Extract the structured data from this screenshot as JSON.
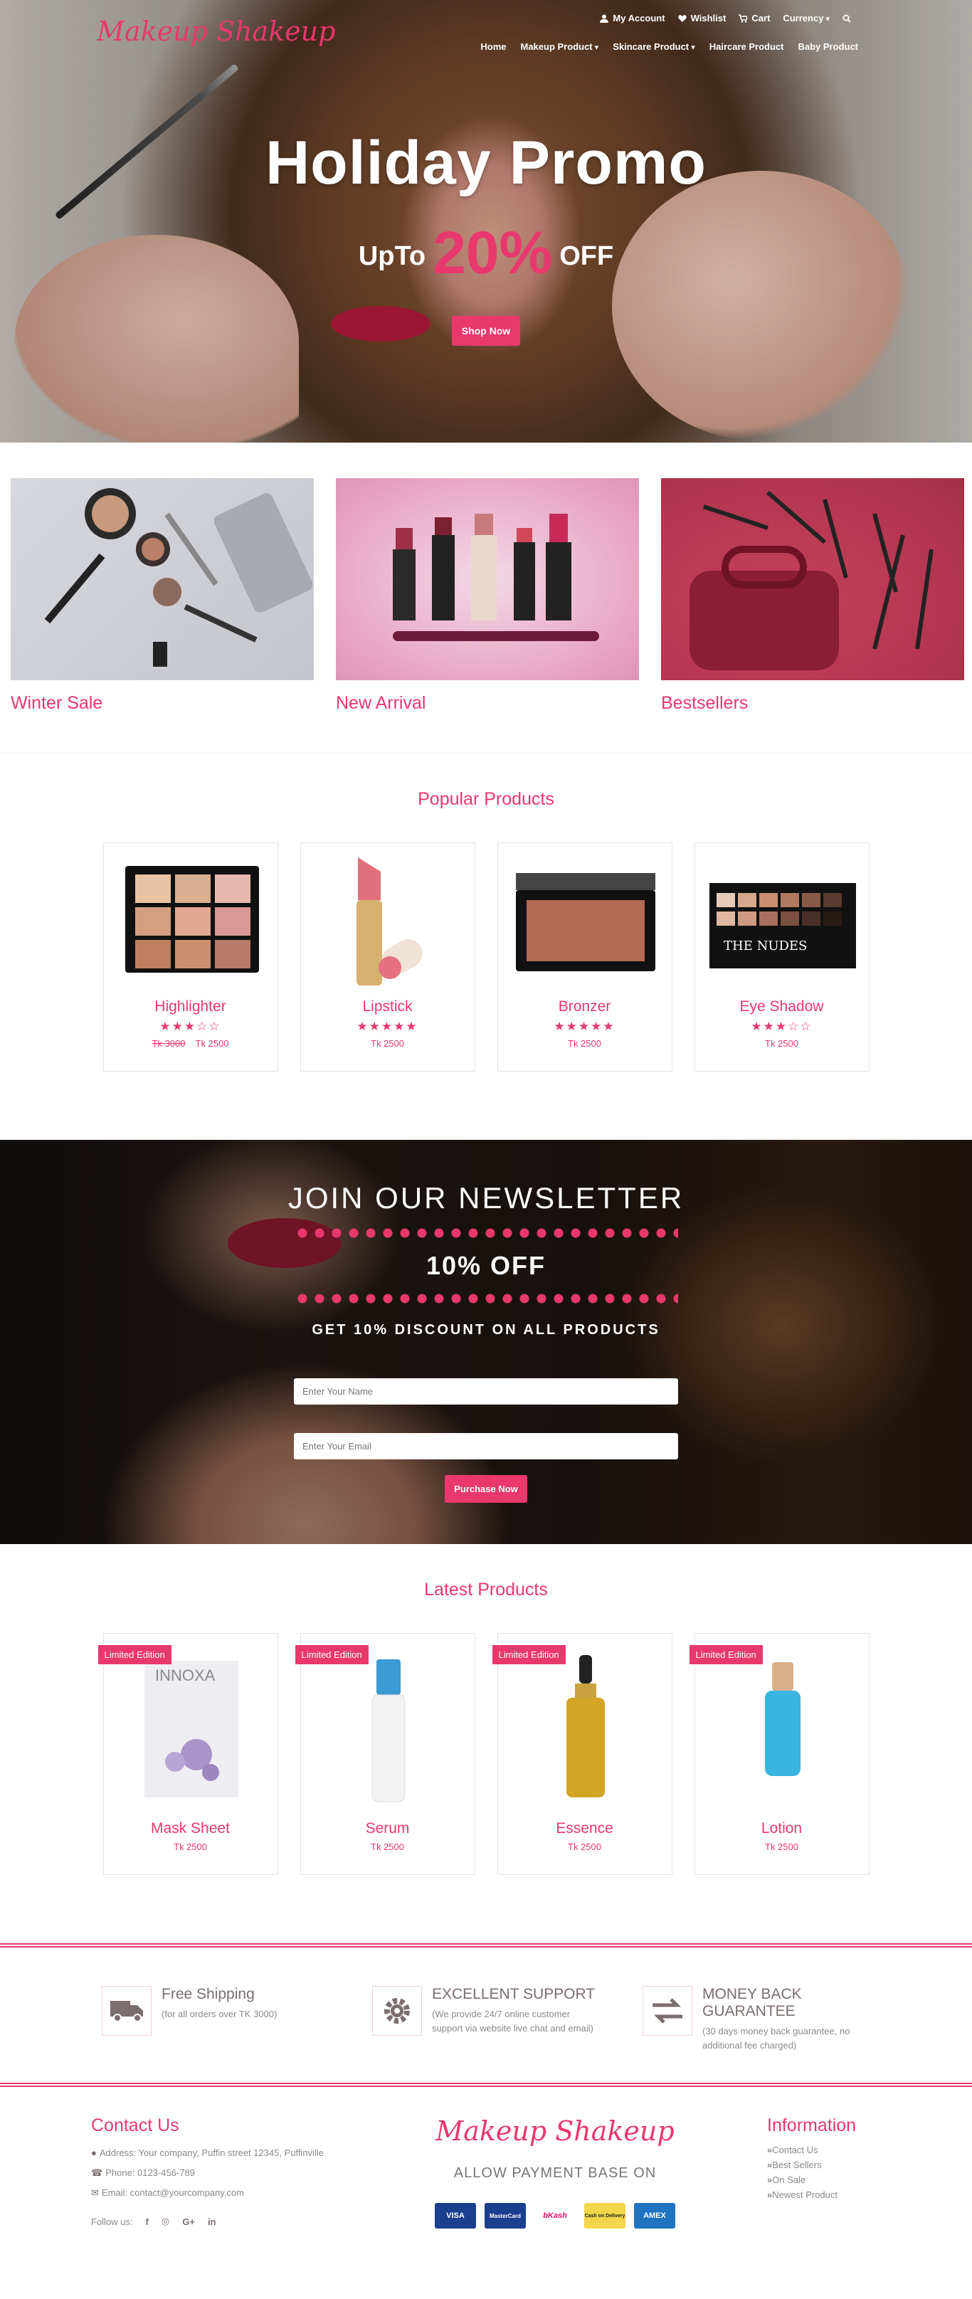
{
  "header": {
    "logo": "Makeup Shakeup",
    "account_links": [
      "My Account",
      "Wishlist",
      "Cart",
      "Currency"
    ],
    "nav": [
      "Home",
      "Makeup Product",
      "Skincare Product",
      "Haircare Product",
      "Baby Product"
    ]
  },
  "hero": {
    "title": "Holiday Promo",
    "prefix": "UpTo",
    "percent": "20%",
    "suffix": "OFF",
    "button": "Shop Now"
  },
  "categories": [
    "Winter Sale",
    "New Arrival",
    "Bestsellers"
  ],
  "popular": {
    "title": "Popular Products",
    "items": [
      {
        "name": "Highlighter",
        "stars": "★★★☆☆",
        "old_price": "Tk 3000",
        "price": "Tk 2500"
      },
      {
        "name": "Lipstick",
        "stars": "★★★★★",
        "old_price": "",
        "price": "Tk 2500"
      },
      {
        "name": "Bronzer",
        "stars": "★★★★★",
        "old_price": "",
        "price": "Tk 2500"
      },
      {
        "name": "Eye Shadow",
        "stars": "★★★☆☆",
        "old_price": "",
        "price": "Tk 2500"
      }
    ]
  },
  "newsletter": {
    "title": "JOIN OUR NEWSLETTER",
    "off": "10% OFF",
    "subtitle": "GET 10% DISCOUNT ON ALL PRODUCTS",
    "name_placeholder": "Enter Your Name",
    "email_placeholder": "Enter Your Email",
    "button": "Purchase Now"
  },
  "latest": {
    "title": "Latest Products",
    "badge": "Limited Edition",
    "items": [
      {
        "name": "Mask Sheet",
        "price": "Tk 2500"
      },
      {
        "name": "Serum",
        "price": "Tk 2500"
      },
      {
        "name": "Essence",
        "price": "Tk 2500"
      },
      {
        "name": "Lotion",
        "price": "Tk 2500"
      }
    ]
  },
  "features": [
    {
      "title": "Free Shipping",
      "desc": "(for all orders over TK 3000)"
    },
    {
      "title": "EXCELLENT SUPPORT",
      "desc": "(We provide 24/7 online customer support via website live chat and email)"
    },
    {
      "title": "MONEY BACK GUARANTEE",
      "desc": "(30 days money back guarantee, no additional fee charged)"
    }
  ],
  "footer": {
    "contact_title": "Contact Us",
    "address": "Address: Your company, Puffin street 12345, Puffinville",
    "phone": "Phone: 0123-456-789",
    "email": "Email: contact@yourcompany.com",
    "follow": "Follow us:",
    "logo": "Makeup Shakeup",
    "allow": "ALLOW PAYMENT BASE ON",
    "payments": [
      "VISA",
      "MasterCard",
      "bKash",
      "Cash on Delivery",
      "AMEX"
    ],
    "info_title": "Information",
    "info_links": [
      "Contact Us",
      "Best Sellers",
      "On Sale",
      "Newest Product"
    ]
  },
  "colors": {
    "accent": "#e8386d"
  }
}
